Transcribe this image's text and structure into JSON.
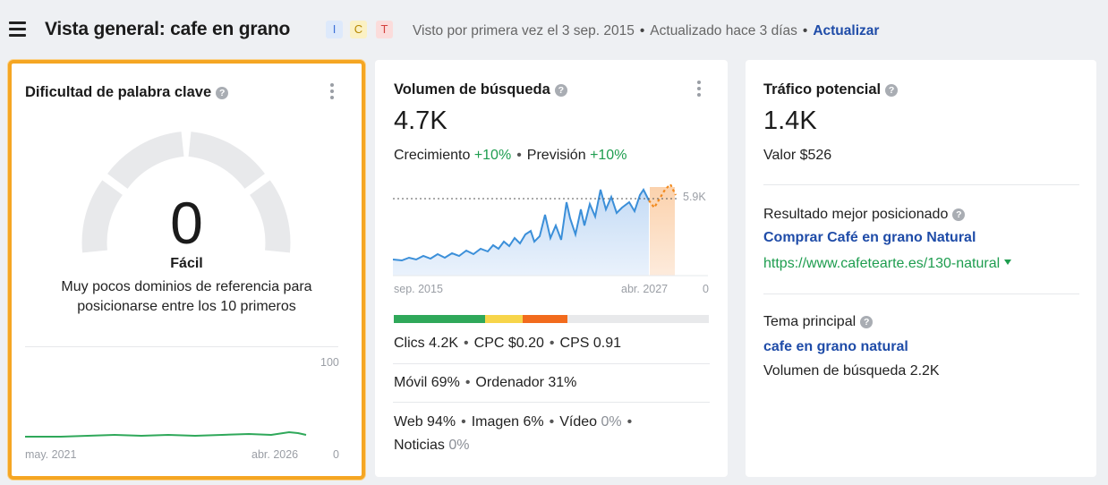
{
  "header": {
    "title": "Vista general: cafe en grano",
    "intents": [
      "I",
      "C",
      "T"
    ],
    "first_seen": "Visto por primera vez el 3 sep. 2015",
    "updated": "Actualizado hace 3 días",
    "refresh": "Actualizar"
  },
  "keyword_difficulty": {
    "title": "Dificultad de palabra clave",
    "value": "0",
    "label": "Fácil",
    "description": "Muy pocos dominios de referencia para posicionarse entre los 10 primeros",
    "chart": {
      "y_max": "100",
      "y_min": "0",
      "x_start": "may. 2021",
      "x_end": "abr. 2026"
    }
  },
  "search_volume": {
    "title": "Volumen de búsqueda",
    "value": "4.7K",
    "growth_label": "Crecimiento",
    "growth_value": "+10%",
    "forecast_label": "Previsión",
    "forecast_value": "+10%",
    "chart": {
      "max_label": "5.9K",
      "y_min": "0",
      "x_start": "sep. 2015",
      "x_end": "abr. 2027"
    },
    "position_distribution": [
      {
        "color": "#2fa85a",
        "share": 0.29
      },
      {
        "color": "#f7d54a",
        "share": 0.12
      },
      {
        "color": "#f26b1d",
        "share": 0.14
      },
      {
        "color": "#e8e9eb",
        "share": 0.45
      }
    ],
    "clicks": "Clics 4.2K",
    "cpc": "CPC $0.20",
    "cps": "CPS 0.91",
    "mobile": "Móvil 69%",
    "desktop": "Ordenador 31%",
    "web": "Web 94%",
    "image": "Imagen 6%",
    "video_label": "Vídeo",
    "video_value": "0%",
    "news_label": "Noticias",
    "news_value": "0%"
  },
  "traffic_potential": {
    "title": "Tráfico potencial",
    "value": "1.4K",
    "worth": "Valor $526",
    "top_result_label": "Resultado mejor posicionado",
    "top_result_title": "Comprar Café en grano Natural",
    "top_result_url": "https://www.cafetearte.es/130-natural",
    "parent_topic_label": "Tema principal",
    "parent_topic": "cafe en grano natural",
    "parent_volume": "Volumen de búsqueda 2.2K"
  }
}
